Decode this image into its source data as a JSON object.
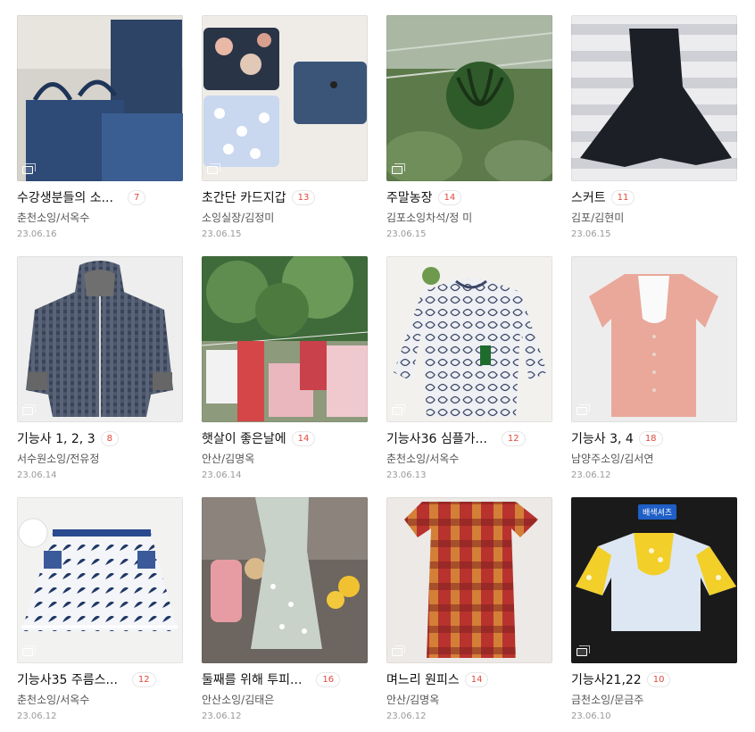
{
  "posts": [
    {
      "title": "수강생분들의 소...",
      "count": "7",
      "author": "춘천소잉/서옥수",
      "date": "23.06.16"
    },
    {
      "title": "초간단 카드지갑",
      "count": "13",
      "author": "소잉실장/김정미",
      "date": "23.06.15"
    },
    {
      "title": "주말농장",
      "count": "14",
      "author": "김포소잉차석/정 미",
      "date": "23.06.15"
    },
    {
      "title": "스커트",
      "count": "11",
      "author": "김포/김현미",
      "date": "23.06.15"
    },
    {
      "title": "기능사 1, 2, 3",
      "count": "8",
      "author": "서수원소잉/전유정",
      "date": "23.06.14"
    },
    {
      "title": "햇살이 좋은날에",
      "count": "14",
      "author": "안산/김명옥",
      "date": "23.06.14"
    },
    {
      "title": "기능사36 심플가...",
      "count": "12",
      "author": "춘천소잉/서옥수",
      "date": "23.06.13"
    },
    {
      "title": "기능사 3, 4",
      "count": "18",
      "author": "남양주소잉/김서연",
      "date": "23.06.12"
    },
    {
      "title": "기능사35 주름스...",
      "count": "12",
      "author": "춘천소잉/서옥수",
      "date": "23.06.12"
    },
    {
      "title": "둘째를 위해 투피...",
      "count": "16",
      "author": "안산소잉/김태은",
      "date": "23.06.12"
    },
    {
      "title": "며느리 원피스",
      "count": "14",
      "author": "안산/김명옥",
      "date": "23.06.12"
    },
    {
      "title": "기능사21,22",
      "count": "10",
      "author": "금천소잉/문금주",
      "date": "23.06.10"
    }
  ],
  "image_badge": "배색셔츠",
  "colors": {
    "count_red": "#e2483d",
    "badge_blue": "#1f5fc7"
  }
}
